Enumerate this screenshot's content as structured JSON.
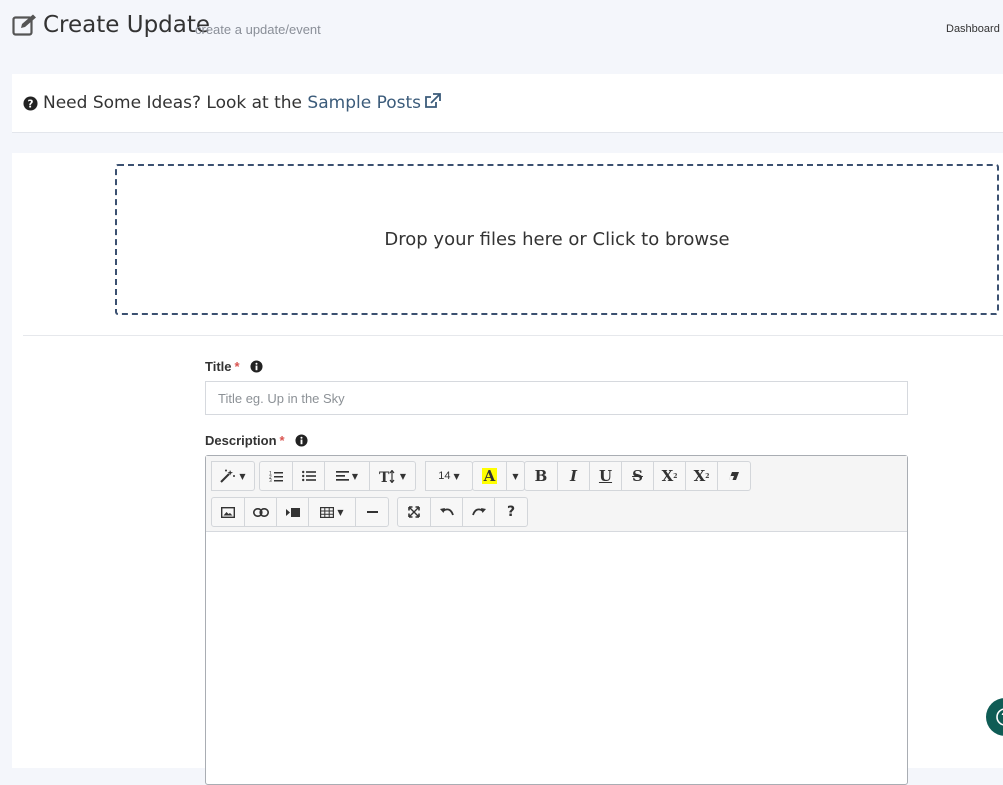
{
  "header": {
    "title": "Create Update",
    "subtitle": "create a update/event",
    "breadcrumb": "Dashboard",
    "icon": "edit-icon"
  },
  "ideas": {
    "prefix": "Need Some Ideas? Look at the ",
    "link_text": "Sample Posts",
    "link_color": "#3b5b7a",
    "icons": [
      "question-circle-icon",
      "external-link-icon"
    ]
  },
  "dropzone": {
    "text": "Drop your files here or Click to browse",
    "border_color": "#3b5070"
  },
  "form": {
    "title_label": "Title",
    "title_placeholder": "Title eg. Up in the Sky",
    "title_value": "",
    "description_label": "Description",
    "required_mark": "*",
    "required_color": "#d9534f"
  },
  "toolbar": {
    "row1": [
      {
        "name": "style",
        "icon": "magic-wand-icon",
        "dropdown": true
      },
      {
        "name": "ordered-list",
        "icon": "ordered-list-icon"
      },
      {
        "name": "unordered-list",
        "icon": "unordered-list-icon"
      },
      {
        "name": "paragraph-align",
        "icon": "align-left-icon",
        "dropdown": true
      },
      {
        "name": "line-height",
        "icon": "text-height-icon",
        "dropdown": true
      },
      {
        "name": "font-size",
        "label": "14",
        "dropdown": true
      },
      {
        "name": "highlight-color",
        "label": "A",
        "highlight": "#ffff00"
      },
      {
        "name": "bold",
        "label": "B"
      },
      {
        "name": "italic",
        "label": "I"
      },
      {
        "name": "underline",
        "label": "U"
      },
      {
        "name": "strikethrough",
        "label": "S"
      },
      {
        "name": "superscript",
        "label": "X²"
      },
      {
        "name": "subscript",
        "label": "X₂"
      },
      {
        "name": "clear-format",
        "icon": "eraser-icon"
      }
    ],
    "row2": [
      {
        "name": "insert-image",
        "icon": "image-icon"
      },
      {
        "name": "insert-link",
        "icon": "link-icon"
      },
      {
        "name": "insert-video",
        "icon": "video-icon"
      },
      {
        "name": "insert-table",
        "icon": "table-icon",
        "dropdown": true
      },
      {
        "name": "horizontal-rule",
        "icon": "minus-icon"
      },
      {
        "name": "fullscreen",
        "icon": "expand-icon"
      },
      {
        "name": "undo",
        "icon": "undo-icon"
      },
      {
        "name": "redo",
        "icon": "redo-icon"
      },
      {
        "name": "help",
        "label": "?"
      }
    ],
    "font_size": "14",
    "highlight_letter": "A",
    "bold": "B",
    "italic": "I",
    "underline": "U",
    "strike": "S",
    "superscript": "X",
    "subscript": "X",
    "help": "?"
  },
  "fab": {
    "icon": "help-circle-icon",
    "color": "#0f5c55"
  }
}
